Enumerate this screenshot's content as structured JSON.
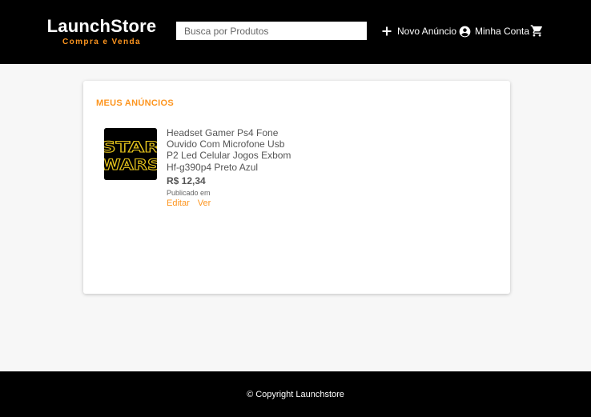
{
  "header": {
    "logo_title": "LaunchStore",
    "logo_subtitle": "Compra e Venda",
    "search_placeholder": "Busca por Produtos",
    "nav": {
      "new_ad": "Novo Anúncio",
      "my_account": "Minha Conta"
    },
    "icons": [
      "plus-icon",
      "account-circle-icon",
      "cart-icon"
    ]
  },
  "main": {
    "section_title": "MEUS ANÚNCIOS",
    "products": [
      {
        "name": "Headset Gamer Ps4 Fone Ouvido Com Microfone Usb P2 Led Celular Jogos Exbom Hf-g390p4 Preto Azul",
        "price": "R$ 12,34",
        "published": "Publicado em",
        "actions": {
          "edit": "Editar",
          "view": "Ver"
        },
        "image_text": [
          "STAR",
          "WARS"
        ]
      }
    ]
  },
  "footer": {
    "copyright": "© Copyright Launchstore"
  },
  "colors": {
    "accent": "#fd951f",
    "header_bg": "#000000",
    "page_bg": "#f7f7f7",
    "card_bg": "#ffffff",
    "logo_text": "#ffffff"
  }
}
